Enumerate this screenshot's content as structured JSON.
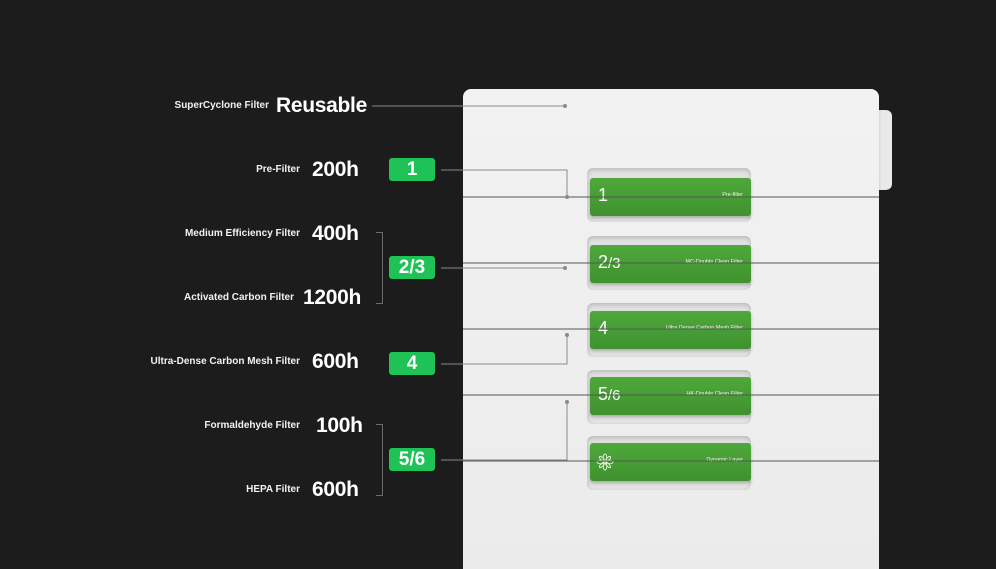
{
  "rows": [
    {
      "label": "SuperCyclone Filter",
      "value": "Reusable"
    },
    {
      "label": "Pre-Filter",
      "value": "200h"
    },
    {
      "label": "Medium Efficiency Filter",
      "value": "400h"
    },
    {
      "label": "Activated Carbon Filter",
      "value": "1200h"
    },
    {
      "label": "Ultra-Dense Carbon Mesh Filter",
      "value": "600h"
    },
    {
      "label": "Formaldehyde Filter",
      "value": "100h"
    },
    {
      "label": "HEPA Filter",
      "value": "600h"
    }
  ],
  "badges": [
    "1",
    "2/3",
    "4",
    "5/6"
  ],
  "panels": [
    {
      "num": "1",
      "sub": "",
      "text": "Pre-filter"
    },
    {
      "num": "2",
      "sub": "/3",
      "text": "MC-Double Clean Filter"
    },
    {
      "num": "4",
      "sub": "",
      "text": "Ultra Dense Carbon Mesh Filter"
    },
    {
      "num": "5",
      "sub": "/6",
      "text": "HK-Double Clean Filter"
    },
    {
      "num": "",
      "sub": "",
      "text": "Dynamic Layer",
      "icon": "flower-icon"
    }
  ],
  "colors": {
    "background": "#1c1c1c",
    "badge": "#1fc257",
    "panel": "#45992f",
    "device": "#f0f0f0"
  }
}
